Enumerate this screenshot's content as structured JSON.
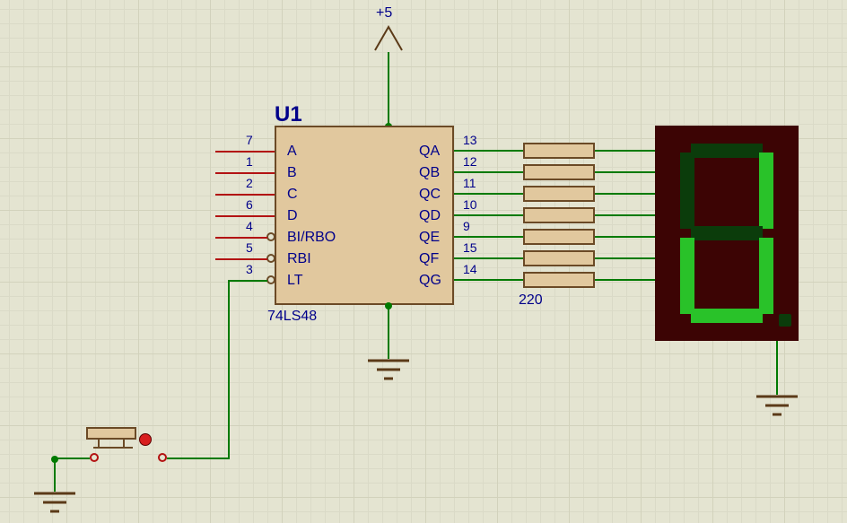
{
  "power": {
    "label": "+5"
  },
  "ic": {
    "ref": "U1",
    "part": "74LS48",
    "pins_left": [
      {
        "name": "A",
        "num": "7"
      },
      {
        "name": "B",
        "num": "1"
      },
      {
        "name": "C",
        "num": "2"
      },
      {
        "name": "D",
        "num": "6"
      },
      {
        "name": "BI/RBO",
        "num": "4"
      },
      {
        "name": "RBI",
        "num": "5"
      },
      {
        "name": "LT",
        "num": "3"
      }
    ],
    "pins_right": [
      {
        "name": "QA",
        "num": "13"
      },
      {
        "name": "QB",
        "num": "12"
      },
      {
        "name": "QC",
        "num": "11"
      },
      {
        "name": "QD",
        "num": "10"
      },
      {
        "name": "QE",
        "num": "9"
      },
      {
        "name": "QF",
        "num": "15"
      },
      {
        "name": "QG",
        "num": "14"
      }
    ]
  },
  "resistor_value": "220",
  "display": {
    "segments": {
      "a": false,
      "b": true,
      "c": true,
      "d": true,
      "e": true,
      "f": false,
      "g": false
    }
  }
}
